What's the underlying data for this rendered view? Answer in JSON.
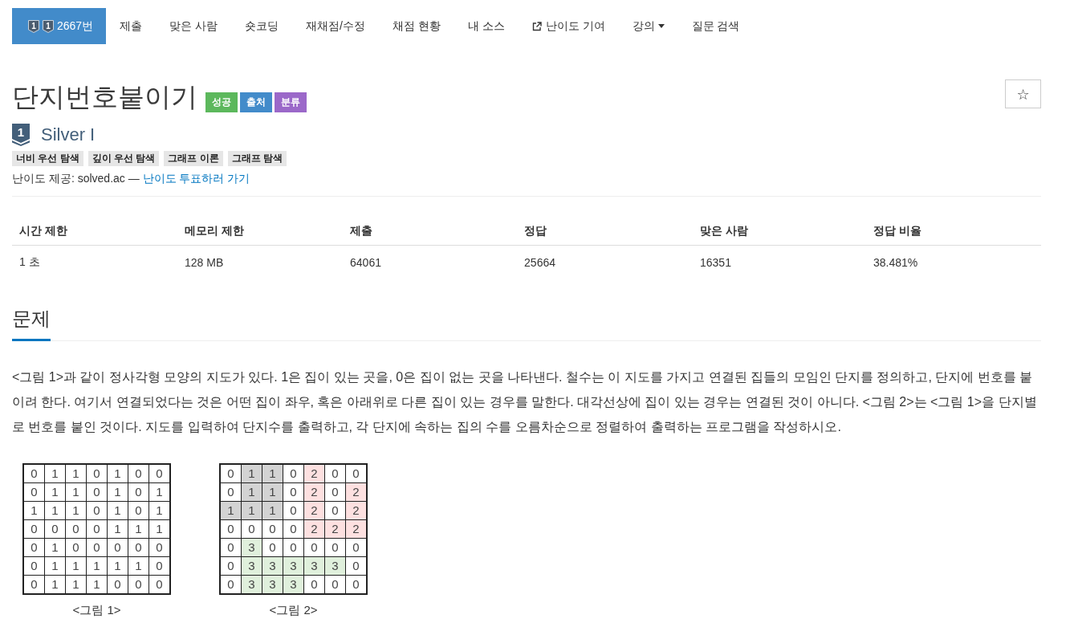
{
  "nav": [
    {
      "kind": "problem",
      "label": "2667번",
      "badges": [
        "1",
        "1"
      ],
      "selected": true
    },
    {
      "kind": "link",
      "label": "제출",
      "selected": false
    },
    {
      "kind": "link",
      "label": "맞은 사람",
      "selected": false
    },
    {
      "kind": "link",
      "label": "숏코딩",
      "selected": false
    },
    {
      "kind": "link",
      "label": "재채점/수정",
      "selected": false
    },
    {
      "kind": "link",
      "label": "채점 현황",
      "selected": false
    },
    {
      "kind": "link",
      "label": "내 소스",
      "selected": false
    },
    {
      "kind": "external",
      "label": "난이도 기여",
      "selected": false
    },
    {
      "kind": "dropdown",
      "label": "강의",
      "selected": false
    },
    {
      "kind": "link",
      "label": "질문 검색",
      "selected": false
    }
  ],
  "header": {
    "title": "단지번호붙이기",
    "labels": [
      {
        "text": "성공",
        "color": "#5cb85c"
      },
      {
        "text": "출처",
        "color": "#428bca"
      },
      {
        "text": "분류",
        "color": "#9b68c9"
      }
    ],
    "favorite_button": "☆"
  },
  "tier": {
    "digit": "1",
    "name": "Silver I"
  },
  "tags": [
    "너비 우선 탐색",
    "깊이 우선 탐색",
    "그래프 이론",
    "그래프 탐색"
  ],
  "difficulty_credit": {
    "text": "난이도 제공: solved.ac — ",
    "link": "난이도 투표하러 가기"
  },
  "info_table": {
    "columns": [
      "시간 제한",
      "메모리 제한",
      "제출",
      "정답",
      "맞은 사람",
      "정답 비율"
    ],
    "rows": [
      [
        "1 초",
        "128 MB",
        "64061",
        "25664",
        "16351",
        "38.481%"
      ]
    ]
  },
  "problem_section": {
    "heading": "문제",
    "statement": "<그림 1>과 같이 정사각형 모양의 지도가 있다. 1은 집이 있는 곳을, 0은 집이 없는 곳을 나타낸다. 철수는 이 지도를 가지고 연결된 집들의 모임인 단지를 정의하고, 단지에 번호를 붙이려 한다. 여기서 연결되었다는 것은 어떤 집이 좌우, 혹은 아래위로 다른 집이 있는 경우를 말한다. 대각선상에 집이 있는 경우는 연결된 것이 아니다. <그림 2>는 <그림 1>을 단지별로 번호를 붙인 것이다. 지도를 입력하여 단지수를 출력하고, 각 단지에 속하는 집의 수를 오름차순으로 정렬하여 출력하는 프로그램을 작성하시오.",
    "figures": [
      {
        "caption": "<그림 1>",
        "rows": [
          [
            {
              "value": "0"
            },
            {
              "value": "1"
            },
            {
              "value": "1"
            },
            {
              "value": "0"
            },
            {
              "value": "1"
            },
            {
              "value": "0"
            },
            {
              "value": "0"
            }
          ],
          [
            {
              "value": "0"
            },
            {
              "value": "1"
            },
            {
              "value": "1"
            },
            {
              "value": "0"
            },
            {
              "value": "1"
            },
            {
              "value": "0"
            },
            {
              "value": "1"
            }
          ],
          [
            {
              "value": "1"
            },
            {
              "value": "1"
            },
            {
              "value": "1"
            },
            {
              "value": "0"
            },
            {
              "value": "1"
            },
            {
              "value": "0"
            },
            {
              "value": "1"
            }
          ],
          [
            {
              "value": "0"
            },
            {
              "value": "0"
            },
            {
              "value": "0"
            },
            {
              "value": "0"
            },
            {
              "value": "1"
            },
            {
              "value": "1"
            },
            {
              "value": "1"
            }
          ],
          [
            {
              "value": "0"
            },
            {
              "value": "1"
            },
            {
              "value": "0"
            },
            {
              "value": "0"
            },
            {
              "value": "0"
            },
            {
              "value": "0"
            },
            {
              "value": "0"
            }
          ],
          [
            {
              "value": "0"
            },
            {
              "value": "1"
            },
            {
              "value": "1"
            },
            {
              "value": "1"
            },
            {
              "value": "1"
            },
            {
              "value": "1"
            },
            {
              "value": "0"
            }
          ],
          [
            {
              "value": "0"
            },
            {
              "value": "1"
            },
            {
              "value": "1"
            },
            {
              "value": "1"
            },
            {
              "value": "0"
            },
            {
              "value": "0"
            },
            {
              "value": "0"
            }
          ]
        ]
      },
      {
        "caption": "<그림 2>",
        "rows": [
          [
            {
              "value": "0"
            },
            {
              "value": "1",
              "color": "#d3d3d3"
            },
            {
              "value": "1",
              "color": "#d3d3d3"
            },
            {
              "value": "0"
            },
            {
              "value": "2",
              "color": "#fde0e0"
            },
            {
              "value": "0"
            },
            {
              "value": "0"
            }
          ],
          [
            {
              "value": "0"
            },
            {
              "value": "1",
              "color": "#d3d3d3"
            },
            {
              "value": "1",
              "color": "#d3d3d3"
            },
            {
              "value": "0"
            },
            {
              "value": "2",
              "color": "#fde0e0"
            },
            {
              "value": "0"
            },
            {
              "value": "2",
              "color": "#fde0e0"
            }
          ],
          [
            {
              "value": "1",
              "color": "#d3d3d3"
            },
            {
              "value": "1",
              "color": "#d3d3d3"
            },
            {
              "value": "1",
              "color": "#d3d3d3"
            },
            {
              "value": "0"
            },
            {
              "value": "2",
              "color": "#fde0e0"
            },
            {
              "value": "0"
            },
            {
              "value": "2",
              "color": "#fde0e0"
            }
          ],
          [
            {
              "value": "0"
            },
            {
              "value": "0"
            },
            {
              "value": "0"
            },
            {
              "value": "0"
            },
            {
              "value": "2",
              "color": "#fde0e0"
            },
            {
              "value": "2",
              "color": "#fde0e0"
            },
            {
              "value": "2",
              "color": "#fde0e0"
            }
          ],
          [
            {
              "value": "0"
            },
            {
              "value": "3",
              "color": "#e0f0dc"
            },
            {
              "value": "0"
            },
            {
              "value": "0"
            },
            {
              "value": "0"
            },
            {
              "value": "0"
            },
            {
              "value": "0"
            }
          ],
          [
            {
              "value": "0"
            },
            {
              "value": "3",
              "color": "#e0f0dc"
            },
            {
              "value": "3",
              "color": "#e0f0dc"
            },
            {
              "value": "3",
              "color": "#e0f0dc"
            },
            {
              "value": "3",
              "color": "#e0f0dc"
            },
            {
              "value": "3",
              "color": "#e0f0dc"
            },
            {
              "value": "0"
            }
          ],
          [
            {
              "value": "0"
            },
            {
              "value": "3",
              "color": "#e0f0dc"
            },
            {
              "value": "3",
              "color": "#e0f0dc"
            },
            {
              "value": "3",
              "color": "#e0f0dc"
            },
            {
              "value": "0"
            },
            {
              "value": "0"
            },
            {
              "value": "0"
            }
          ]
        ]
      }
    ]
  }
}
